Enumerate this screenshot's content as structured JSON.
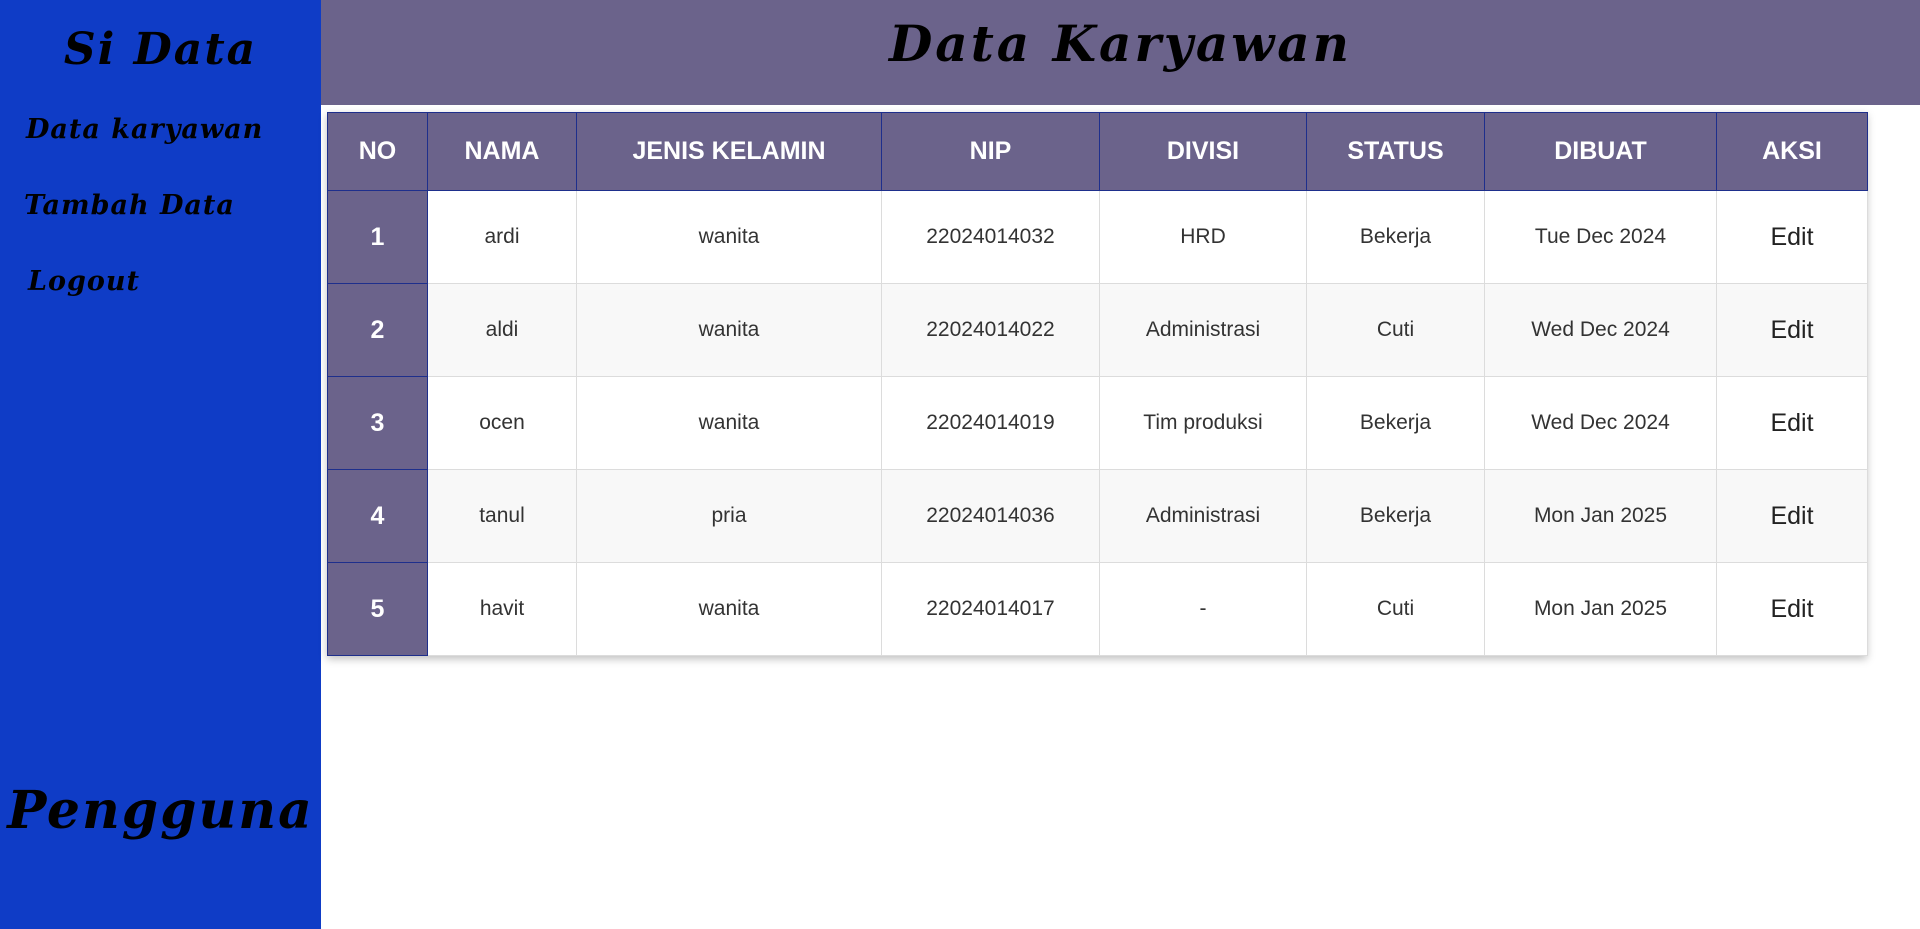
{
  "sidebar": {
    "brand": "Si Data",
    "items": [
      {
        "label": "Data karyawan"
      },
      {
        "label": "Tambah Data"
      },
      {
        "label": "Logout"
      }
    ],
    "user_label": "Pengguna"
  },
  "header": {
    "title": "Data Karyawan"
  },
  "table": {
    "columns": [
      "NO",
      "NAMA",
      "JENIS KELAMIN",
      "NIP",
      "DIVISI",
      "STATUS",
      "DIBUAT",
      "AKSI"
    ],
    "rows": [
      {
        "no": "1",
        "nama": "ardi",
        "jenis_kelamin": "wanita",
        "nip": "22024014032",
        "divisi": "HRD",
        "status": "Bekerja",
        "dibuat": "Tue Dec 2024",
        "aksi": "Edit"
      },
      {
        "no": "2",
        "nama": "aldi",
        "jenis_kelamin": "wanita",
        "nip": "22024014022",
        "divisi": "Administrasi",
        "status": "Cuti",
        "dibuat": "Wed Dec 2024",
        "aksi": "Edit"
      },
      {
        "no": "3",
        "nama": "ocen",
        "jenis_kelamin": "wanita",
        "nip": "22024014019",
        "divisi": "Tim produksi",
        "status": "Bekerja",
        "dibuat": "Wed Dec 2024",
        "aksi": "Edit"
      },
      {
        "no": "4",
        "nama": "tanul",
        "jenis_kelamin": "pria",
        "nip": "22024014036",
        "divisi": "Administrasi",
        "status": "Bekerja",
        "dibuat": "Mon Jan 2025",
        "aksi": "Edit"
      },
      {
        "no": "5",
        "nama": "havit",
        "jenis_kelamin": "wanita",
        "nip": "22024014017",
        "divisi": "-",
        "status": "Cuti",
        "dibuat": "Mon Jan 2025",
        "aksi": "Edit"
      }
    ]
  },
  "colors": {
    "sidebar_bg": "#0f3cc6",
    "header_bg": "#6b638b",
    "table_border": "#1e2f8c"
  }
}
